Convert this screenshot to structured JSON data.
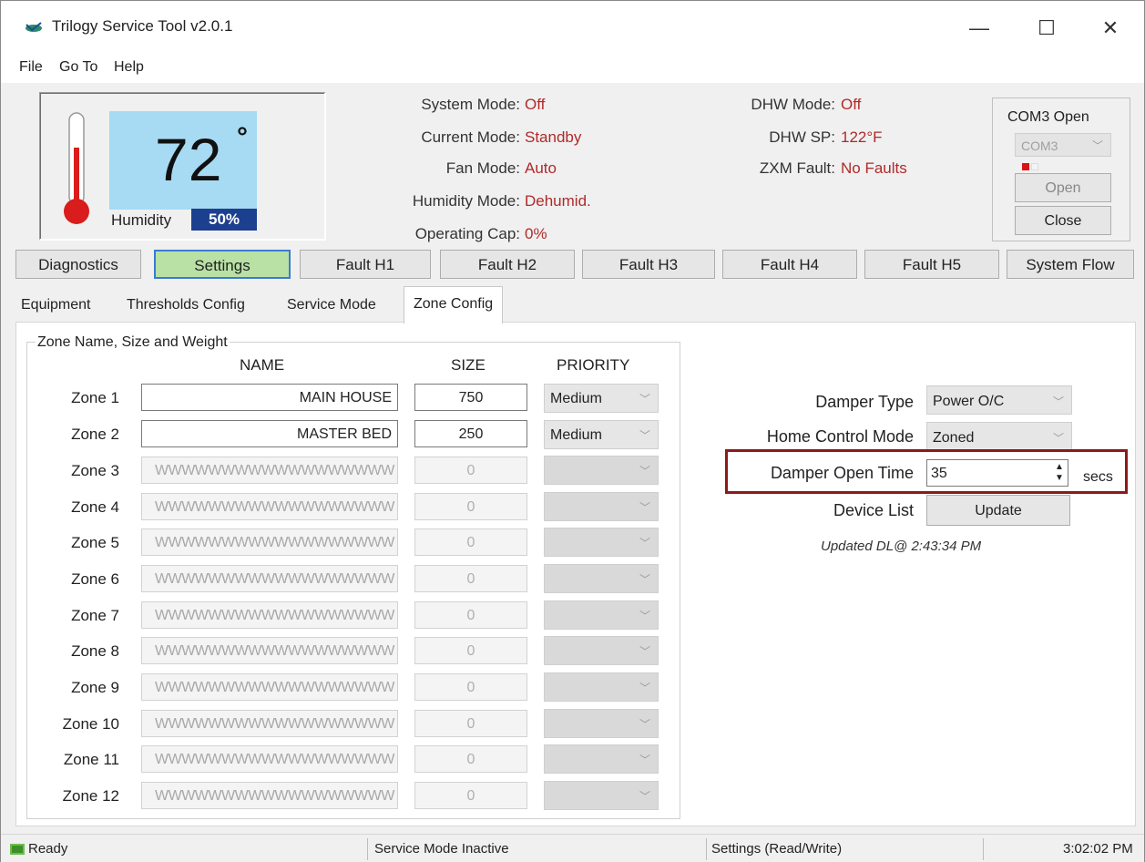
{
  "window": {
    "title": "Trilogy Service Tool  v2.0.1"
  },
  "menu": [
    "File",
    "Go To",
    "Help"
  ],
  "thermostat": {
    "temperature": "72",
    "degree_symbol": "°",
    "humidity_label": "Humidity",
    "humidity_value": "50%"
  },
  "status_left": [
    {
      "label": "System Mode:",
      "value": "Off"
    },
    {
      "label": "Current Mode:",
      "value": "Standby"
    },
    {
      "label": "Fan Mode:",
      "value": "Auto"
    },
    {
      "label": "Humidity Mode:",
      "value": "Dehumid."
    },
    {
      "label": "Operating Cap:",
      "value": "0%"
    }
  ],
  "status_right": [
    {
      "label": "DHW Mode:",
      "value": "Off"
    },
    {
      "label": "DHW SP:",
      "value": "122°F"
    },
    {
      "label": "ZXM Fault:",
      "value": "No Faults"
    }
  ],
  "com": {
    "title": "COM3 Open",
    "port": "COM3",
    "open_label": "Open",
    "close_label": "Close"
  },
  "main_tabs": [
    "Diagnostics",
    "Settings",
    "Fault H1",
    "Fault H2",
    "Fault H3",
    "Fault H4",
    "Fault H5",
    "System Flow"
  ],
  "sub_tabs": [
    "Equipment",
    "Thresholds Config",
    "Service Mode",
    "Zone Config"
  ],
  "zone_group": {
    "title": "Zone Name, Size and Weight",
    "headers": {
      "name": "NAME",
      "size": "SIZE",
      "priority": "PRIORITY"
    },
    "zones": [
      {
        "label": "Zone 1",
        "name": "MAIN HOUSE",
        "size": "750",
        "priority": "Medium"
      },
      {
        "label": "Zone 2",
        "name": "MASTER BED",
        "size": "250",
        "priority": "Medium"
      },
      {
        "label": "Zone 3",
        "name": "WWWWWWWWWWWWWWWWWW",
        "size": "0",
        "priority": ""
      },
      {
        "label": "Zone 4",
        "name": "WWWWWWWWWWWWWWWWWW",
        "size": "0",
        "priority": ""
      },
      {
        "label": "Zone 5",
        "name": "WWWWWWWWWWWWWWWWWW",
        "size": "0",
        "priority": ""
      },
      {
        "label": "Zone 6",
        "name": "WWWWWWWWWWWWWWWWWW",
        "size": "0",
        "priority": ""
      },
      {
        "label": "Zone 7",
        "name": "WWWWWWWWWWWWWWWWWW",
        "size": "0",
        "priority": ""
      },
      {
        "label": "Zone 8",
        "name": "WWWWWWWWWWWWWWWWWW",
        "size": "0",
        "priority": ""
      },
      {
        "label": "Zone 9",
        "name": "WWWWWWWWWWWWWWWWWW",
        "size": "0",
        "priority": ""
      },
      {
        "label": "Zone 10",
        "name": "WWWWWWWWWWWWWWWWWW",
        "size": "0",
        "priority": ""
      },
      {
        "label": "Zone 11",
        "name": "WWWWWWWWWWWWWWWWWW",
        "size": "0",
        "priority": ""
      },
      {
        "label": "Zone 12",
        "name": "WWWWWWWWWWWWWWWWWW",
        "size": "0",
        "priority": ""
      }
    ]
  },
  "config": {
    "damper_type_label": "Damper Type",
    "damper_type_value": "Power O/C",
    "home_control_label": "Home Control Mode",
    "home_control_value": "Zoned",
    "damper_open_label": "Damper Open Time",
    "damper_open_value": "35",
    "damper_open_unit": "secs",
    "device_list_label": "Device List",
    "update_label": "Update",
    "updated_note": "Updated DL@ 2:43:34 PM"
  },
  "statusbar": {
    "ready": "Ready",
    "service": "Service Mode Inactive",
    "settings": "Settings (Read/Write)",
    "time": "3:02:02 PM"
  },
  "colors": {
    "accent_value": "#b02a2a",
    "temp_bg": "#a6dbf3",
    "humidity_bg": "#1d3f8f",
    "active_tab": "#b9e0a5",
    "highlight": "#8b1a1a"
  }
}
